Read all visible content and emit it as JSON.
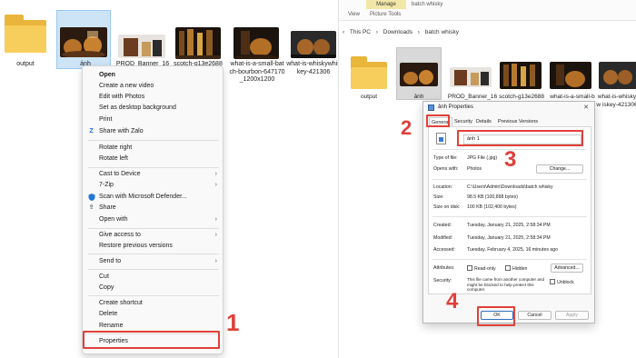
{
  "left": {
    "files": [
      {
        "name": "output",
        "kind": "folder"
      },
      {
        "name": "ảnh",
        "kind": "image",
        "selected": true
      },
      {
        "name": "PROD_Banner_16",
        "kind": "image"
      },
      {
        "name": "scotch-g13e2688",
        "kind": "image"
      },
      {
        "name": "what-is-a-small-batch-bourbon-647170_1200x1200",
        "kind": "image"
      },
      {
        "name": "what-is-whiskywhiskey-421306",
        "kind": "image"
      }
    ],
    "menu": {
      "open": "Open",
      "new_video": "Create a new video",
      "edit_photos": "Edit with Photos",
      "set_bg": "Set as desktop background",
      "print": "Print",
      "share_zalo": "Share with Zalo",
      "rotate_right": "Rotate right",
      "rotate_left": "Rotate left",
      "cast": "Cast to Device",
      "zip": "7-Zip",
      "defender": "Scan with Microsoft Defender...",
      "share": "Share",
      "open_with": "Open with",
      "give_access": "Give access to",
      "restore": "Restore previous versions",
      "send_to": "Send to",
      "cut": "Cut",
      "copy": "Copy",
      "shortcut": "Create shortcut",
      "delete": "Delete",
      "rename": "Rename",
      "properties": "Properties"
    },
    "step": "1"
  },
  "right": {
    "ribbon": {
      "manage": "Manage",
      "folder_name": "batch whisky",
      "view": "View",
      "picture_tools": "Picture Tools"
    },
    "address": {
      "back": "‹",
      "crumbs": [
        "This PC",
        "Downloads",
        "batch whisky"
      ],
      "sep": "›"
    },
    "files": [
      {
        "name": "output"
      },
      {
        "name": "ảnh"
      },
      {
        "name": "PROD_Banner_16"
      },
      {
        "name": "scotch-g13e2688"
      },
      {
        "name": "what-is-a-small-b"
      },
      {
        "name": "what-is-whiskyw iskey-421306"
      }
    ],
    "dialog": {
      "title": "ảnh Properties",
      "close": "✕",
      "tabs": [
        "General",
        "Security",
        "Details",
        "Previous Versions"
      ],
      "filename": "ảnh 1",
      "type_label": "Type of file:",
      "type_value": "JPG File (.jpg)",
      "opens_label": "Opens with:",
      "opens_value": "Photos",
      "change": "Change...",
      "location_label": "Location:",
      "location_value": "C:\\Users\\Admin\\Downloads\\batch whisky",
      "size_label": "Size:",
      "size_value": "98.5 KB (100,898 bytes)",
      "disk_label": "Size on disk:",
      "disk_value": "100 KB (102,400 bytes)",
      "created_label": "Created:",
      "created_value": "Tuesday, January 21, 2025, 2:58:34 PM",
      "modified_label": "Modified:",
      "modified_value": "Tuesday, January 21, 2025, 2:58:34 PM",
      "accessed_label": "Accessed:",
      "accessed_value": "Tuesday, February 4, 2025, 16 minutes ago",
      "attributes_label": "Attributes:",
      "readonly": "Read-only",
      "hidden": "Hidden",
      "advanced": "Advanced...",
      "security_label": "Security:",
      "security_text": "This file came from another computer and might be blocked to help protect this computer.",
      "unblock": "Unblock",
      "ok": "OK",
      "cancel": "Cancel",
      "apply": "Apply"
    },
    "steps": [
      "2",
      "3",
      "4"
    ]
  },
  "colors": {
    "annotation": "#e0403a",
    "folder": "#f7ce5c",
    "selection": "#cde4f7",
    "manage_tab": "#f3e7a8"
  }
}
